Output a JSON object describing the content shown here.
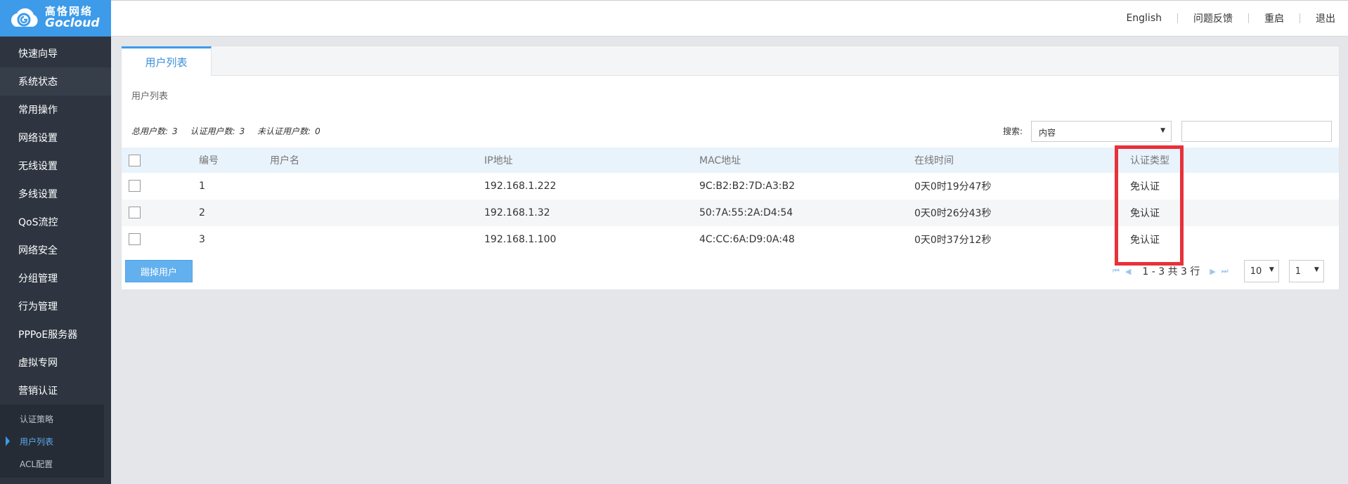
{
  "brand": {
    "name_cn": "高恪网络",
    "name_en": "Gocloud"
  },
  "topbar": {
    "links": [
      "English",
      "问题反馈",
      "重启",
      "退出"
    ]
  },
  "sidebar": {
    "items": [
      "快速向导",
      "系统状态",
      "常用操作",
      "网络设置",
      "无线设置",
      "多线设置",
      "QoS流控",
      "网络安全",
      "分组管理",
      "行为管理",
      "PPPoE服务器",
      "虚拟专网",
      "营销认证"
    ],
    "subitems": [
      "认证策略",
      "用户列表",
      "ACL配置"
    ]
  },
  "tab": {
    "label": "用户列表"
  },
  "section": {
    "title": "用户列表"
  },
  "stats": {
    "total_label": "总用户数:",
    "total": "3",
    "auth_label": "认证用户数:",
    "auth": "3",
    "unauth_label": "未认证用户数:",
    "unauth": "0"
  },
  "search": {
    "label": "搜索:",
    "selected": "内容",
    "value": ""
  },
  "table": {
    "headers": [
      "编号",
      "用户名",
      "IP地址",
      "MAC地址",
      "在线时间",
      "认证类型"
    ],
    "rows": [
      {
        "id": "1",
        "user": "",
        "ip": "192.168.1.222",
        "mac": "9C:B2:B2:7D:A3:B2",
        "time": "0天0时19分47秒",
        "type": "免认证"
      },
      {
        "id": "2",
        "user": "",
        "ip": "192.168.1.32",
        "mac": "50:7A:55:2A:D4:54",
        "time": "0天0时26分43秒",
        "type": "免认证"
      },
      {
        "id": "3",
        "user": "",
        "ip": "192.168.1.100",
        "mac": "4C:CC:6A:D9:0A:48",
        "time": "0天0时37分12秒",
        "type": "免认证"
      }
    ]
  },
  "actions": {
    "kick_label": "踢掉用户"
  },
  "pager": {
    "summary": "1 - 3 共 3 行",
    "page_size": "10",
    "page": "1"
  },
  "colors": {
    "accent": "#3d9be9",
    "sidebar": "#2e3540",
    "highlight": "#e8313a"
  }
}
